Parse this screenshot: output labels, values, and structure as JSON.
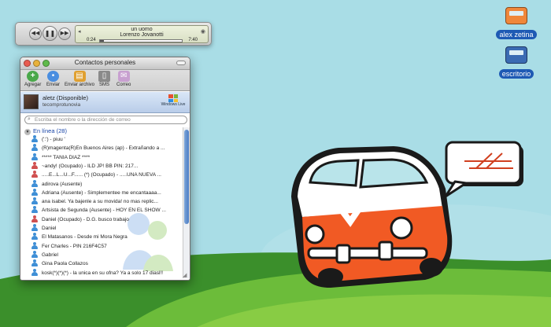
{
  "desktop": {
    "icons": [
      {
        "label": "alex zetina",
        "icon": "orange-van-icon"
      },
      {
        "label": "escritorio",
        "icon": "blue-van-icon"
      }
    ],
    "colors": {
      "sky": "#a9dde6",
      "grass": "#6cbc3a",
      "van_orange": "#f15a24"
    }
  },
  "itunes": {
    "song": "un uomo",
    "artist": "Lorenzo Jovanotti",
    "elapsed": "0:24",
    "total": "7:40",
    "progress": 0.05,
    "controls": [
      "previous-icon",
      "play-pause-icon",
      "next-icon"
    ]
  },
  "messenger": {
    "title": "Contactos personales",
    "toolbar": [
      {
        "label": "Agregar",
        "icon": "add-contact-icon"
      },
      {
        "label": "Enviar",
        "icon": "send-message-icon"
      },
      {
        "label": "Enviar archivo",
        "icon": "send-file-icon"
      },
      {
        "label": "SMS",
        "icon": "sms-icon"
      },
      {
        "label": "Correo",
        "icon": "mail-icon"
      }
    ],
    "profile": {
      "name": "aletz (Disponible)",
      "message": "tecomprotunovia",
      "brand": "Windows Live"
    },
    "search_placeholder": "Escriba el nombre o la dirección de correo",
    "group": "En línea (28)",
    "contacts": [
      {
        "name": "(':') - piuu '",
        "status": "online"
      },
      {
        "name": "(R)magenta(R)En  Buenos Aires (ap) - Extrañando a ...",
        "status": "online"
      },
      {
        "name": "***** TANIA DIAZ ****",
        "status": "online"
      },
      {
        "name": "~andy! (Ocupado) - ILD JP!        BB PIN: 217...",
        "status": "busy"
      },
      {
        "name": ".....E...L...U...F......  (*) (Ocupado) - .....UNA NUEVA ...",
        "status": "busy"
      },
      {
        "name": "adirova (Ausente)",
        "status": "online"
      },
      {
        "name": "Adriana (Ausente) - Simplementee me encantaaaa...",
        "status": "online"
      },
      {
        "name": "ana isabel. Ya bajenle a su movida!   no mas replic...",
        "status": "online"
      },
      {
        "name": "Artsista de Segunda (Ausente) - HOY EN EL SHOW ...",
        "status": "online"
      },
      {
        "name": "Daniel (Ocupado) - D.G. busco trabajo",
        "status": "busy"
      },
      {
        "name": "Daniel",
        "status": "online"
      },
      {
        "name": "El Matasanos - Desde mi Mora Negra",
        "status": "online"
      },
      {
        "name": "Fer Charles - PIN 216F4C57",
        "status": "online"
      },
      {
        "name": "Gabriel",
        "status": "online"
      },
      {
        "name": "Gina Paola Collazos",
        "status": "online"
      },
      {
        "name": "kosk(*)(*)(*) - la unica en su ofna? Ya a solo 17 diasl!!",
        "status": "online"
      }
    ]
  }
}
